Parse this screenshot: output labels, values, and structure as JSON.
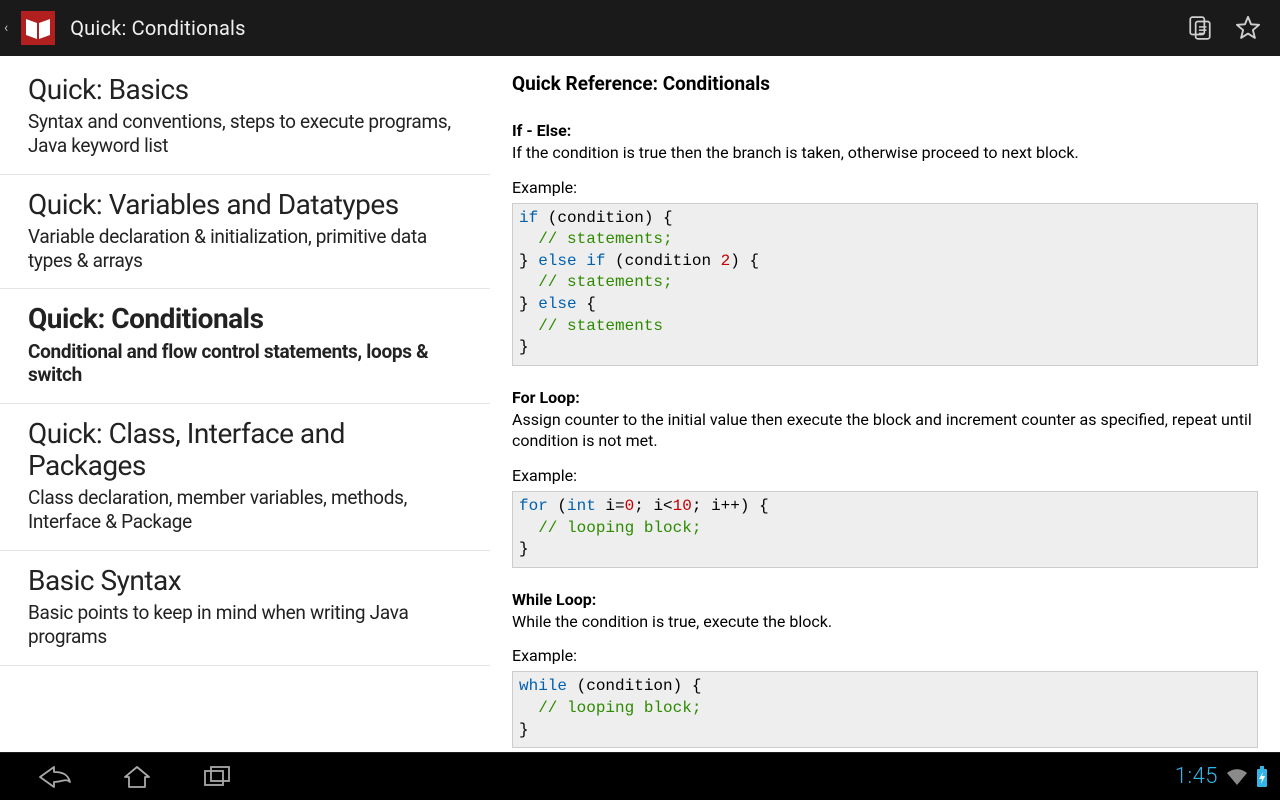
{
  "header": {
    "title": "Quick: Conditionals",
    "actions": {
      "copy": "copy-icon",
      "star": "star-icon"
    }
  },
  "sidebar": {
    "items": [
      {
        "title": "Quick: Basics",
        "desc": "Syntax and conventions, steps to execute programs, Java keyword list",
        "selected": false
      },
      {
        "title": "Quick: Variables and Datatypes",
        "desc": "Variable declaration & initialization, primitive data types & arrays",
        "selected": false
      },
      {
        "title": "Quick: Conditionals",
        "desc": "Conditional and flow control statements, loops & switch",
        "selected": true
      },
      {
        "title": "Quick: Class, Interface and Packages",
        "desc": "Class declaration, member variables, methods, Interface & Package",
        "selected": false
      },
      {
        "title": "Basic Syntax",
        "desc": "Basic points to keep in mind when writing Java programs",
        "selected": false
      }
    ]
  },
  "detail": {
    "heading": "Quick Reference: Conditionals",
    "example_label": "Example:",
    "sections": [
      {
        "title": "If - Else:",
        "body": "If the condition is true then the branch is taken, otherwise proceed to next block.",
        "code": [
          {
            "t": "kw",
            "v": "if"
          },
          {
            "t": "",
            "v": " (condition) {\n  "
          },
          {
            "t": "cm",
            "v": "// statements;"
          },
          {
            "t": "",
            "v": "\n} "
          },
          {
            "t": "kw",
            "v": "else if"
          },
          {
            "t": "",
            "v": " (condition "
          },
          {
            "t": "num",
            "v": "2"
          },
          {
            "t": "",
            "v": ") {\n  "
          },
          {
            "t": "cm",
            "v": "// statements;"
          },
          {
            "t": "",
            "v": "\n} "
          },
          {
            "t": "kw",
            "v": "else"
          },
          {
            "t": "",
            "v": " {\n  "
          },
          {
            "t": "cm",
            "v": "// statements"
          },
          {
            "t": "",
            "v": "\n}"
          }
        ]
      },
      {
        "title": "For Loop:",
        "body": "Assign counter to the initial value then execute the block and increment counter as specified, repeat until condition is not met.",
        "code": [
          {
            "t": "kw",
            "v": "for"
          },
          {
            "t": "",
            "v": " ("
          },
          {
            "t": "kw",
            "v": "int"
          },
          {
            "t": "",
            "v": " i="
          },
          {
            "t": "num",
            "v": "0"
          },
          {
            "t": "",
            "v": "; i<"
          },
          {
            "t": "num",
            "v": "10"
          },
          {
            "t": "",
            "v": "; i++) {\n  "
          },
          {
            "t": "cm",
            "v": "// looping block;"
          },
          {
            "t": "",
            "v": "\n}"
          }
        ]
      },
      {
        "title": "While Loop:",
        "body": "While the condition is true, execute the block.",
        "code": [
          {
            "t": "kw",
            "v": "while"
          },
          {
            "t": "",
            "v": " (condition) {\n  "
          },
          {
            "t": "cm",
            "v": "// looping block;"
          },
          {
            "t": "",
            "v": "\n}"
          }
        ]
      }
    ]
  },
  "navbar": {
    "clock": "1:45"
  }
}
